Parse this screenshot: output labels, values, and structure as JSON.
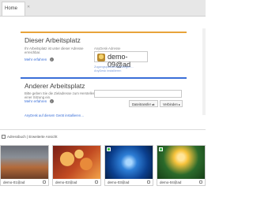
{
  "tabs": [
    {
      "label": "Home"
    }
  ],
  "this_workstation": {
    "title": "Dieser Arbeitsplatz",
    "description": "Ihr Arbeitsplatz ist unter dieser Adresse erreichbar.",
    "more_link": "Mehr erfahren",
    "address_label": "AnyDesk-Adresse",
    "address_value": "demo-09@ad",
    "help_link_1": "Zugangspasswort festlegen…",
    "help_link_2": "AnyDesk installieren"
  },
  "other_workstation": {
    "title": "Anderer Arbeitsplatz",
    "description": "Bitte geben Sie die Zieladresse zum Herstellen einer Sitzung ein.",
    "more_link": "Mehr erfahren",
    "password_placeholder": "",
    "btn_transfer": "Dateitransfer",
    "btn_connect": "Verbinden"
  },
  "footer_link": "AnyDesk auf diesem Gerät installieren…",
  "bottom_bar": {
    "label": "Adressbuch  |  Erweiterte Ansicht"
  },
  "thumbnails": [
    {
      "name": "demo-01@ad"
    },
    {
      "name": "demo-02@ad"
    },
    {
      "name": "demo-03@ad"
    },
    {
      "name": "demo-04@ad"
    }
  ],
  "colors": {
    "accent_orange": "#e8a33a",
    "accent_blue": "#3a6fd8",
    "online": "#3cc04b"
  }
}
